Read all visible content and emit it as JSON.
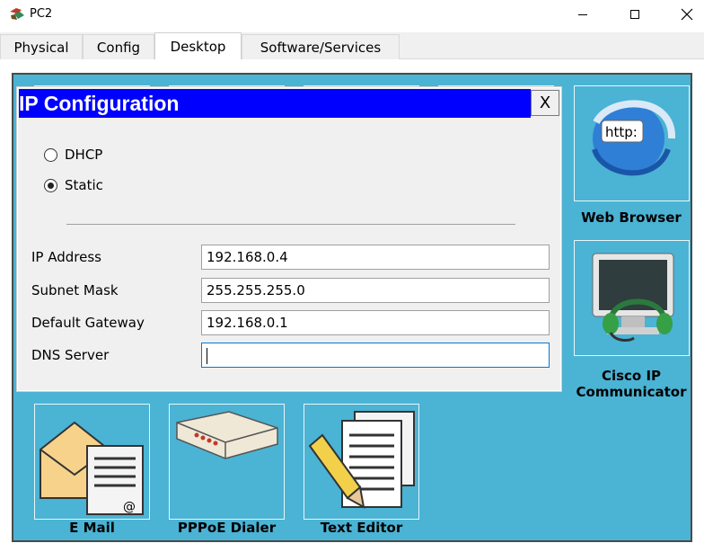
{
  "window": {
    "title": "PC2",
    "controls": {
      "minimize": "minimize-icon",
      "maximize": "maximize-icon",
      "close": "close-icon"
    }
  },
  "tabs": [
    {
      "label": "Physical",
      "active": false
    },
    {
      "label": "Config",
      "active": false
    },
    {
      "label": "Desktop",
      "active": true
    },
    {
      "label": "Software/Services",
      "active": false
    }
  ],
  "desktop": {
    "background_color": "#4bb3d4",
    "apps": [
      {
        "label": "Web Browser",
        "icon": "web-browser-icon"
      },
      {
        "label_line1": "Cisco IP",
        "label_line2": "Communicator",
        "icon": "headset-monitor-icon"
      },
      {
        "label": "E Mail",
        "icon": "email-icon"
      },
      {
        "label": "PPPoE Dialer",
        "icon": "modem-icon"
      },
      {
        "label": "Text Editor",
        "icon": "text-editor-icon"
      }
    ],
    "web_browser_icon_text": "http:"
  },
  "ip_config": {
    "title": "IP Configuration",
    "close_label": "X",
    "title_color": "#0000ff",
    "mode_options": [
      {
        "label": "DHCP",
        "selected": false
      },
      {
        "label": "Static",
        "selected": true
      }
    ],
    "fields": [
      {
        "label": "IP Address",
        "value": "192.168.0.4"
      },
      {
        "label": "Subnet Mask",
        "value": "255.255.255.0"
      },
      {
        "label": "Default Gateway",
        "value": "192.168.0.1"
      },
      {
        "label": "DNS Server",
        "value": ""
      }
    ]
  }
}
